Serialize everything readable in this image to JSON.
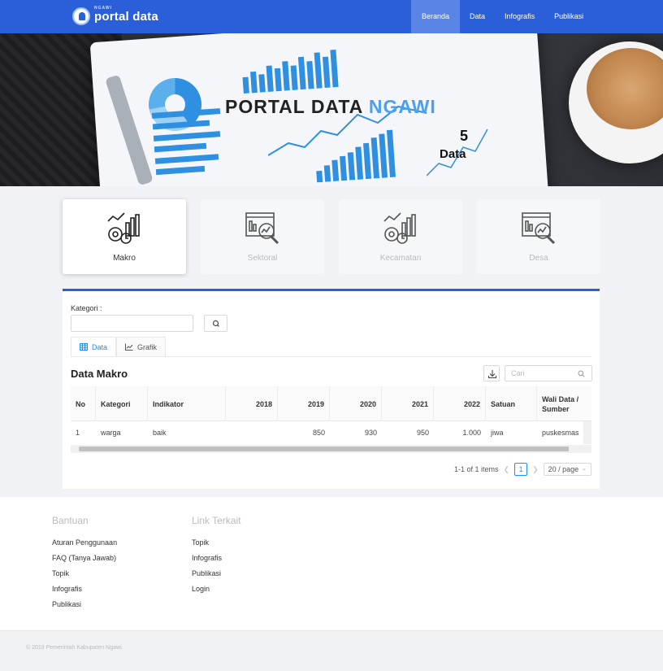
{
  "header": {
    "logo_small": "NGAWI",
    "logo_main": "portal data",
    "nav": [
      {
        "label": "Beranda",
        "active": true
      },
      {
        "label": "Data",
        "active": false
      },
      {
        "label": "Infografis",
        "active": false
      },
      {
        "label": "Publikasi",
        "active": false
      }
    ]
  },
  "hero": {
    "title_main": "PORTAL DATA ",
    "title_accent": "NGAWI",
    "count": "5",
    "count_label": "Data"
  },
  "categories": [
    {
      "label": "Makro",
      "icon": "chart-gears-icon",
      "active": true
    },
    {
      "label": "Sektoral",
      "icon": "report-magnifier-icon",
      "active": false
    },
    {
      "label": "Kecamatan",
      "icon": "chart-gears-icon",
      "active": false
    },
    {
      "label": "Desa",
      "icon": "report-magnifier-icon",
      "active": false
    }
  ],
  "filter": {
    "kategori_label": "Kategori :",
    "kategori_value": ""
  },
  "tabs": [
    {
      "label": "Data",
      "icon": "table-icon",
      "active": true
    },
    {
      "label": "Grafik",
      "icon": "line-chart-icon",
      "active": false
    }
  ],
  "table": {
    "title": "Data Makro",
    "search_placeholder": "Cari",
    "columns": [
      "No",
      "Kategori",
      "Indikator",
      "2018",
      "2019",
      "2020",
      "2021",
      "2022",
      "Satuan",
      "Wali Data / Sumber"
    ],
    "rows": [
      [
        "1",
        "warga",
        "baik",
        "",
        "850",
        "930",
        "950",
        "1.000",
        "jiwa",
        "puskesmas"
      ]
    ]
  },
  "pagination": {
    "summary": "1-1 of 1 items",
    "current_page": "1",
    "page_size": "20 / page"
  },
  "footer": {
    "col1_title": "Bantuan",
    "col1_links": [
      "Aturan Penggunaan",
      "FAQ (Tanya Jawab)",
      "Topik",
      "Infografis",
      "Publikasi"
    ],
    "col2_title": "Link Terkait",
    "col2_links": [
      "Topik",
      "Infografis",
      "Publikasi",
      "Login"
    ],
    "copyright": "© 2019 Pemerintah Kabupaten Ngawi."
  },
  "colors": {
    "brand": "#2b5fd9",
    "accent": "#1890ff",
    "hero_accent": "#4da0f0"
  }
}
